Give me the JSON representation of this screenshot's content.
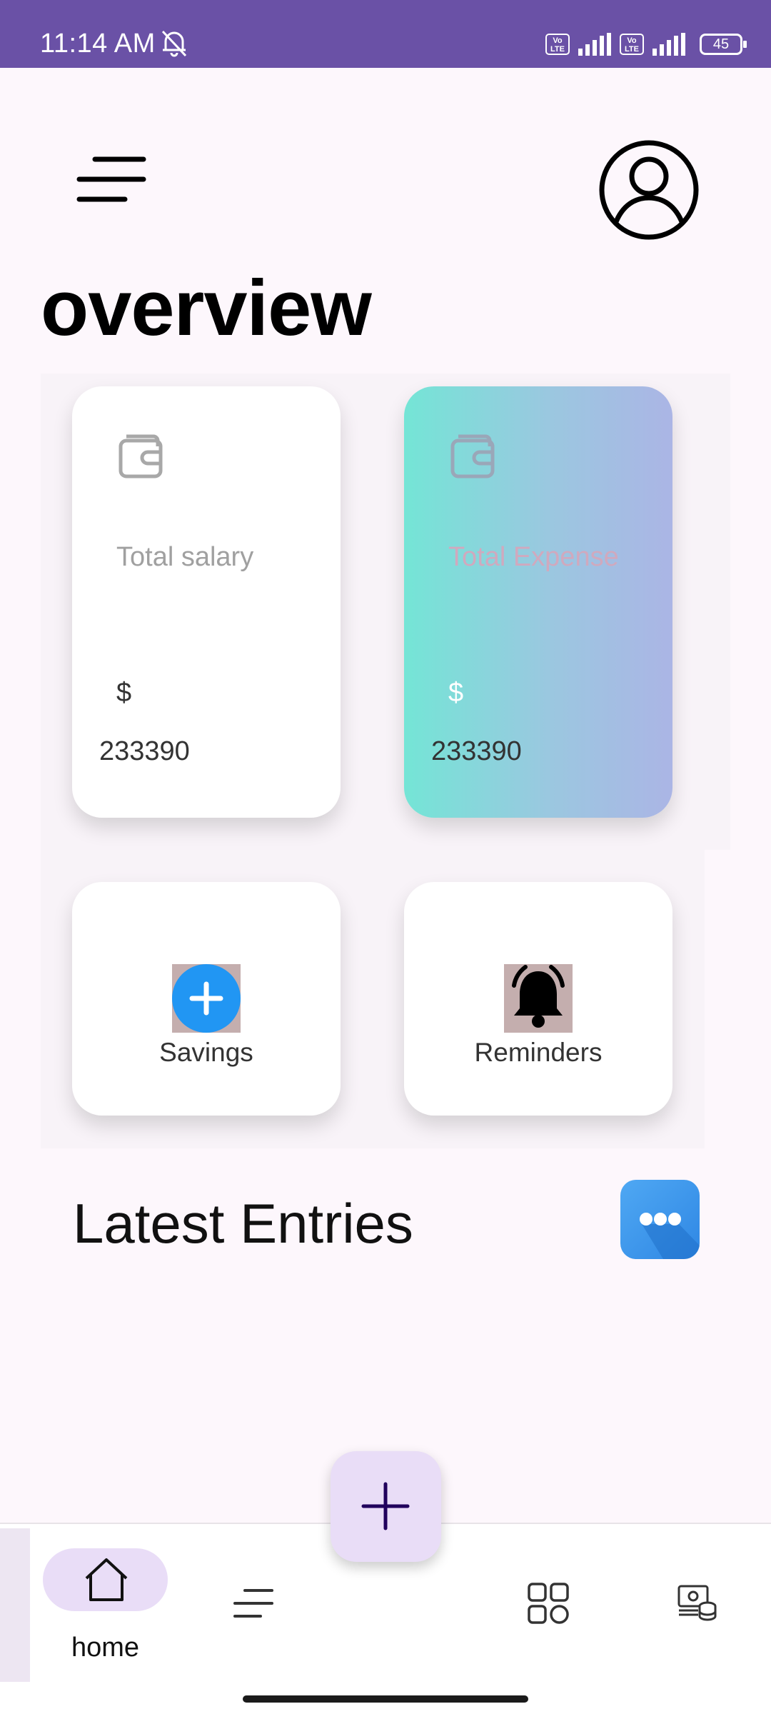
{
  "status_bar": {
    "time": "11:14 AM",
    "volte_1": "Vo LTE",
    "volte_2": "Vo LTE",
    "battery": "45",
    "background_color": "#6A51A6"
  },
  "header": {
    "menu_icon": "menu-icon",
    "profile_icon": "account-circle-icon"
  },
  "page_title": "overview",
  "summary": {
    "salary": {
      "label": "Total salary",
      "currency": "$",
      "amount": "233390",
      "icon": "wallet-icon"
    },
    "expense": {
      "label": "Total Expense",
      "currency": "$",
      "amount": "233390",
      "icon": "wallet-icon"
    }
  },
  "shortcuts": {
    "savings": {
      "label": "Savings",
      "icon": "add-circle-icon"
    },
    "reminders": {
      "label": "Reminders",
      "icon": "bell-icon"
    }
  },
  "latest_entries": {
    "title": "Latest Entries",
    "more_icon": "more-horizontal-icon"
  },
  "bottom_nav": {
    "home_label": "home",
    "items": [
      "home-icon",
      "list-icon",
      "grid-icon",
      "money-icon"
    ],
    "fab_icon": "plus-icon",
    "accent_color": "#E9DDF7"
  }
}
